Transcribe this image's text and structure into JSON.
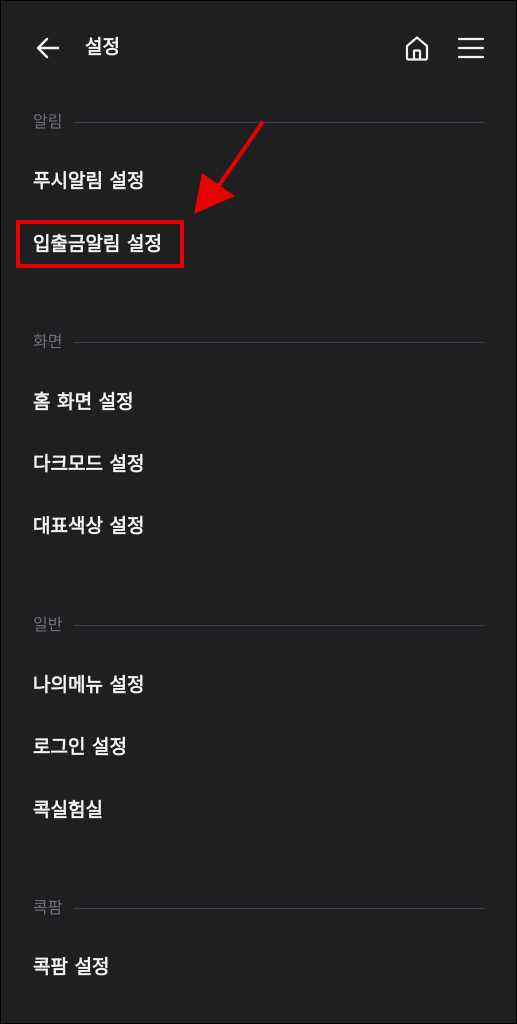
{
  "header": {
    "title": "설정",
    "back_icon": "arrow-left-icon",
    "home_icon": "home-icon",
    "menu_icon": "hamburger-menu-icon"
  },
  "sections": [
    {
      "label": "알림",
      "items": [
        {
          "label": "푸시알림 설정"
        },
        {
          "label": "입출금알림 설정",
          "highlighted": true
        }
      ]
    },
    {
      "label": "화면",
      "items": [
        {
          "label": "홈 화면 설정"
        },
        {
          "label": "다크모드 설정"
        },
        {
          "label": "대표색상 설정"
        }
      ]
    },
    {
      "label": "일반",
      "items": [
        {
          "label": "나의메뉴 설정"
        },
        {
          "label": "로그인 설정"
        },
        {
          "label": "콕실험실"
        }
      ]
    },
    {
      "label": "콕팜",
      "items": [
        {
          "label": "콕팜 설정"
        }
      ]
    }
  ],
  "colors": {
    "background": "#1f1f22",
    "text": "#f4f4f4",
    "section_label": "#6f7178",
    "divider": "#3b3c42",
    "annotation": "#e60000"
  }
}
